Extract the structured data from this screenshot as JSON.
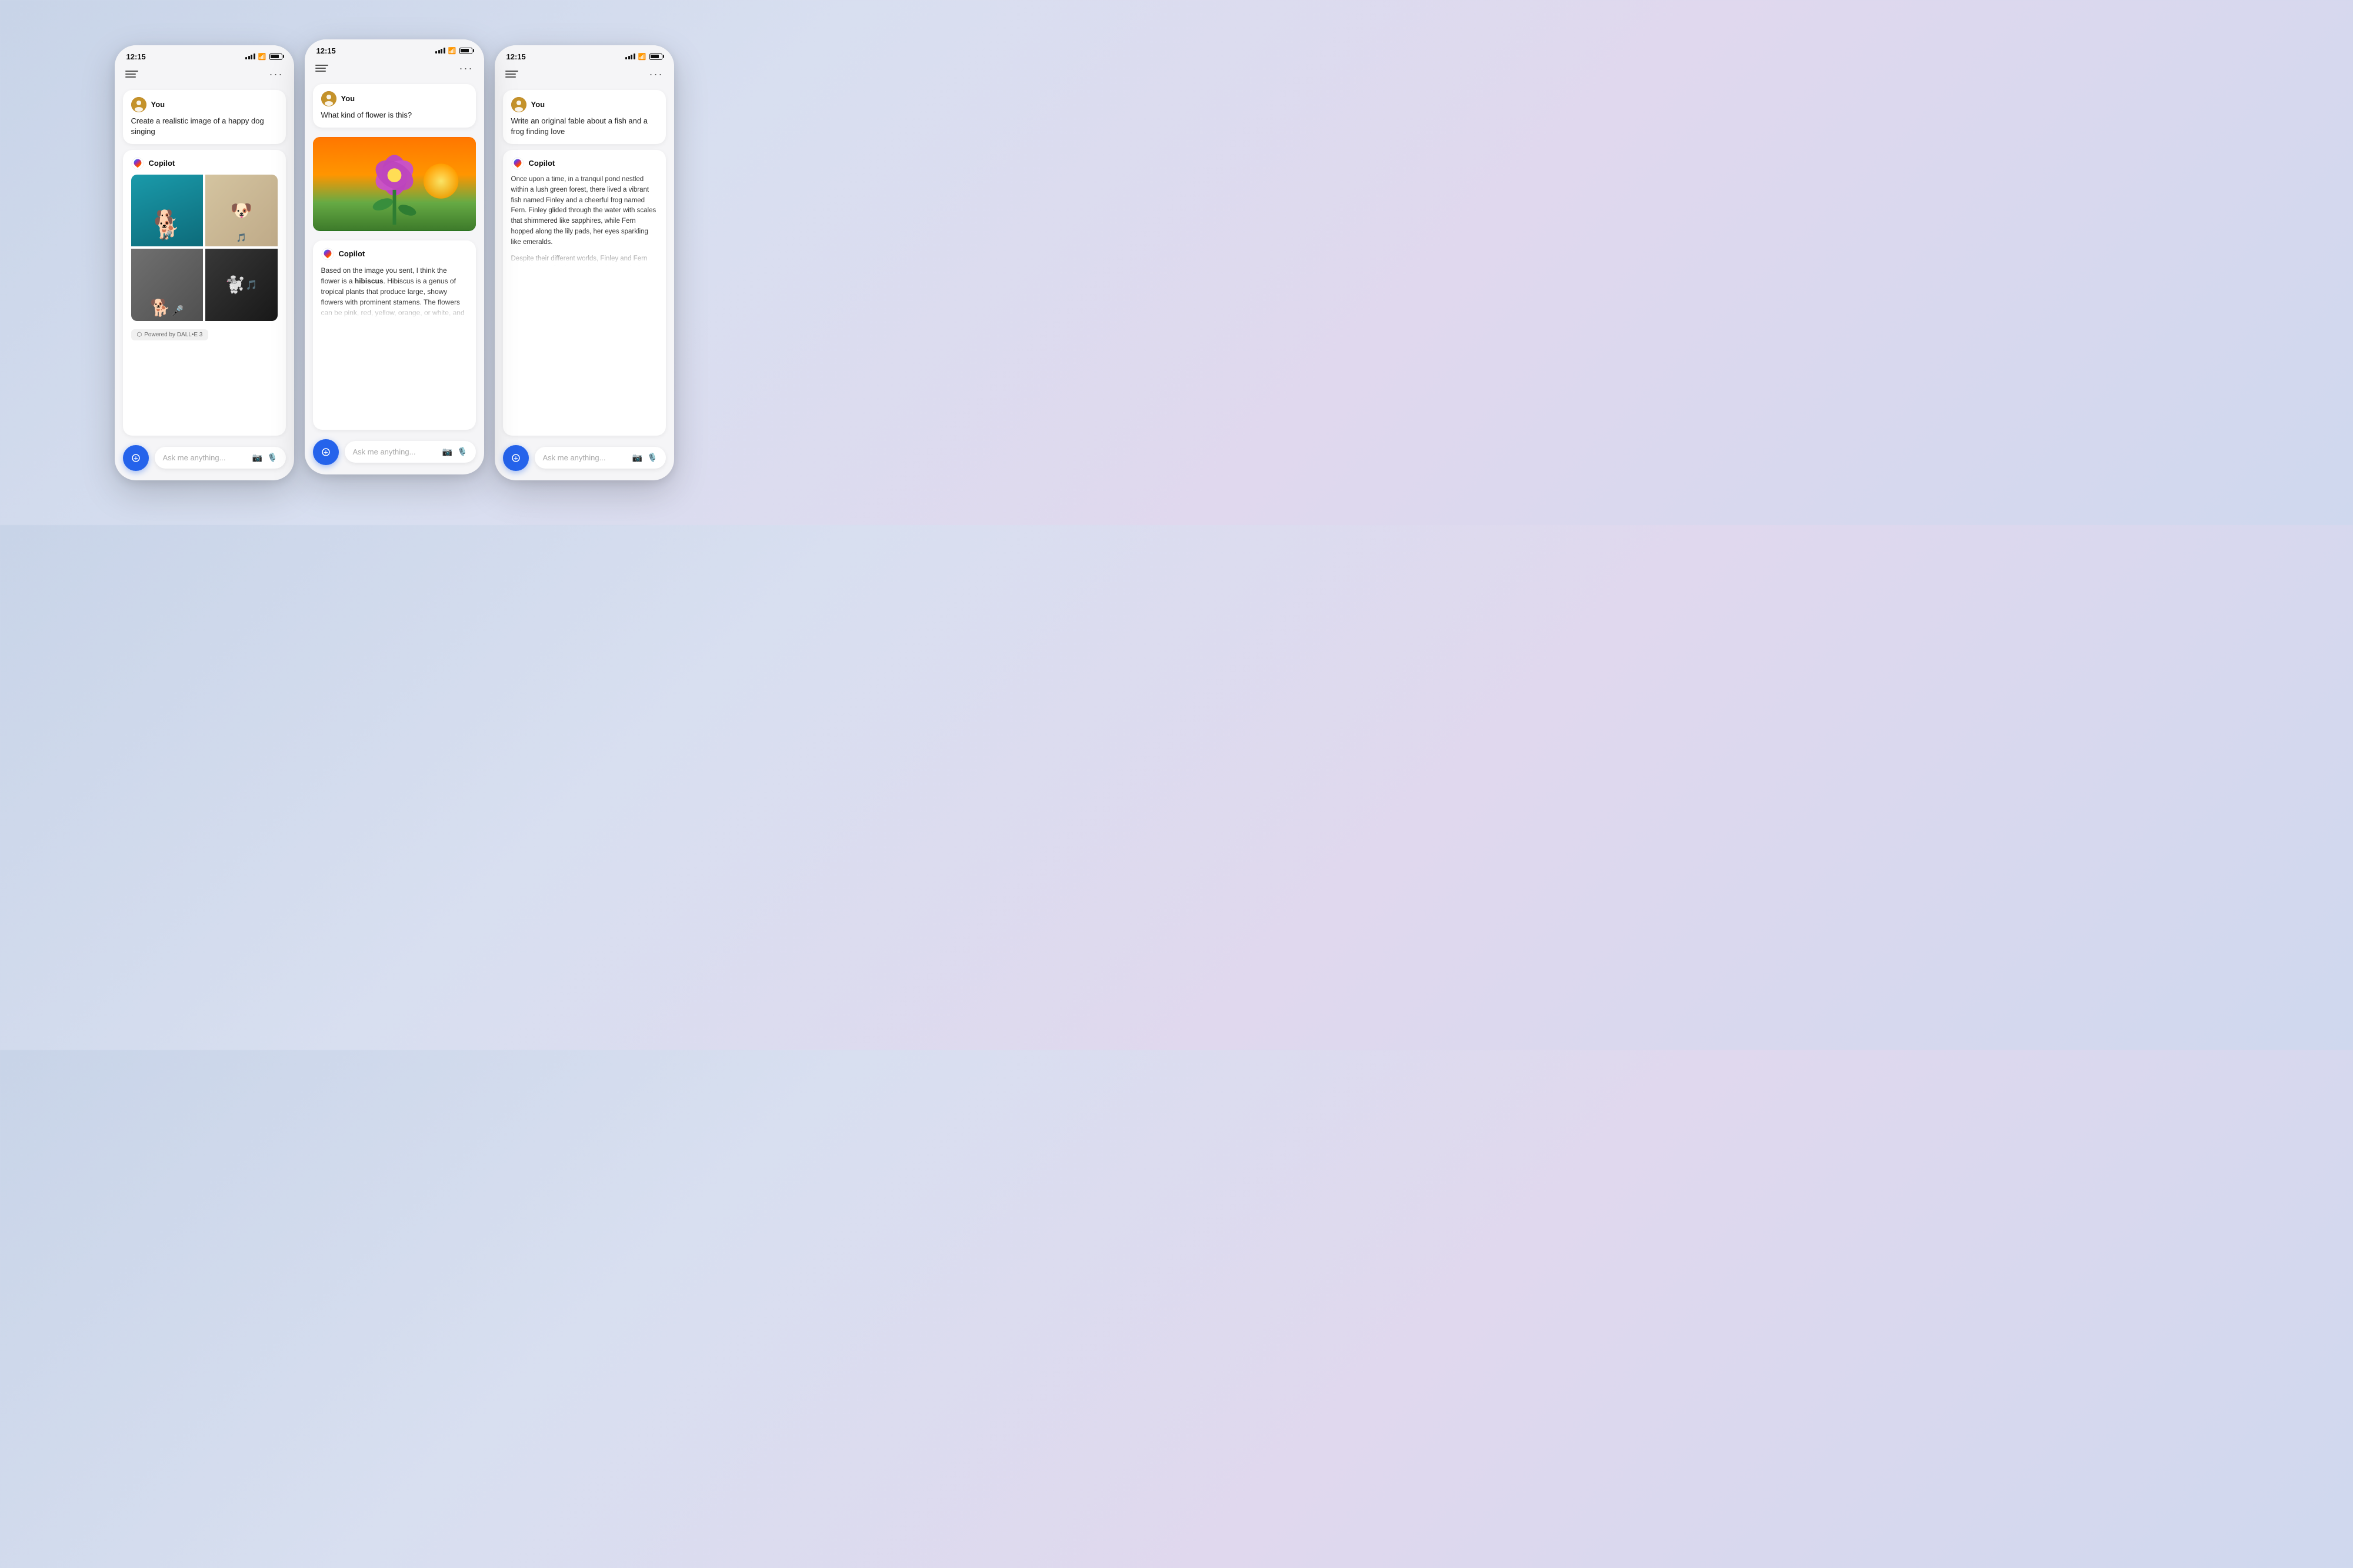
{
  "app": {
    "time": "12:15",
    "name": "Copilot"
  },
  "phone_left": {
    "status_time": "12:15",
    "user_label": "You",
    "user_message": "Create a realistic image of a happy dog singing",
    "copilot_label": "Copilot",
    "powered_label": "Powered by DALL•E 3",
    "input_placeholder": "Ask me anything...",
    "menu_label": "menu",
    "more_label": "more options"
  },
  "phone_center": {
    "status_time": "12:15",
    "user_label": "You",
    "user_message": "What kind of flower is this?",
    "copilot_label": "Copilot",
    "copilot_response": "Based on the image you sent, I think the flower is a hibiscus. Hibiscus is a genus of tropical plants that produce large, showy flowers with prominent stamens. The flowers can be pink, red, yellow, orange, or white, and they often have a contrasting eye in the",
    "hibiscus_word": "hibiscus",
    "input_placeholder": "Ask me anything...",
    "menu_label": "menu",
    "more_label": "more options"
  },
  "phone_right": {
    "status_time": "12:15",
    "user_label": "You",
    "user_message": "Write an original fable about a fish and a frog finding love",
    "copilot_label": "Copilot",
    "copilot_story_p1": "Once upon a time, in a tranquil pond nestled within a lush green forest, there lived a vibrant fish named Finley and a cheerful frog named Fern. Finley glided through the water with scales that shimmered like sapphires, while Fern hopped along the lily pads, her eyes sparkling like emeralds.",
    "copilot_story_p2": "Despite their different worlds, Finley and Fern shared a love for the pond's melody at dusk. Each evening, as the sun dipped below",
    "input_placeholder": "Ask me anything...",
    "menu_label": "menu",
    "more_label": "more options"
  },
  "icons": {
    "camera": "📷",
    "mic": "🎤",
    "copilot_fab": "⊕",
    "user_avatar": "👤",
    "menu": "≡",
    "more": "···"
  }
}
